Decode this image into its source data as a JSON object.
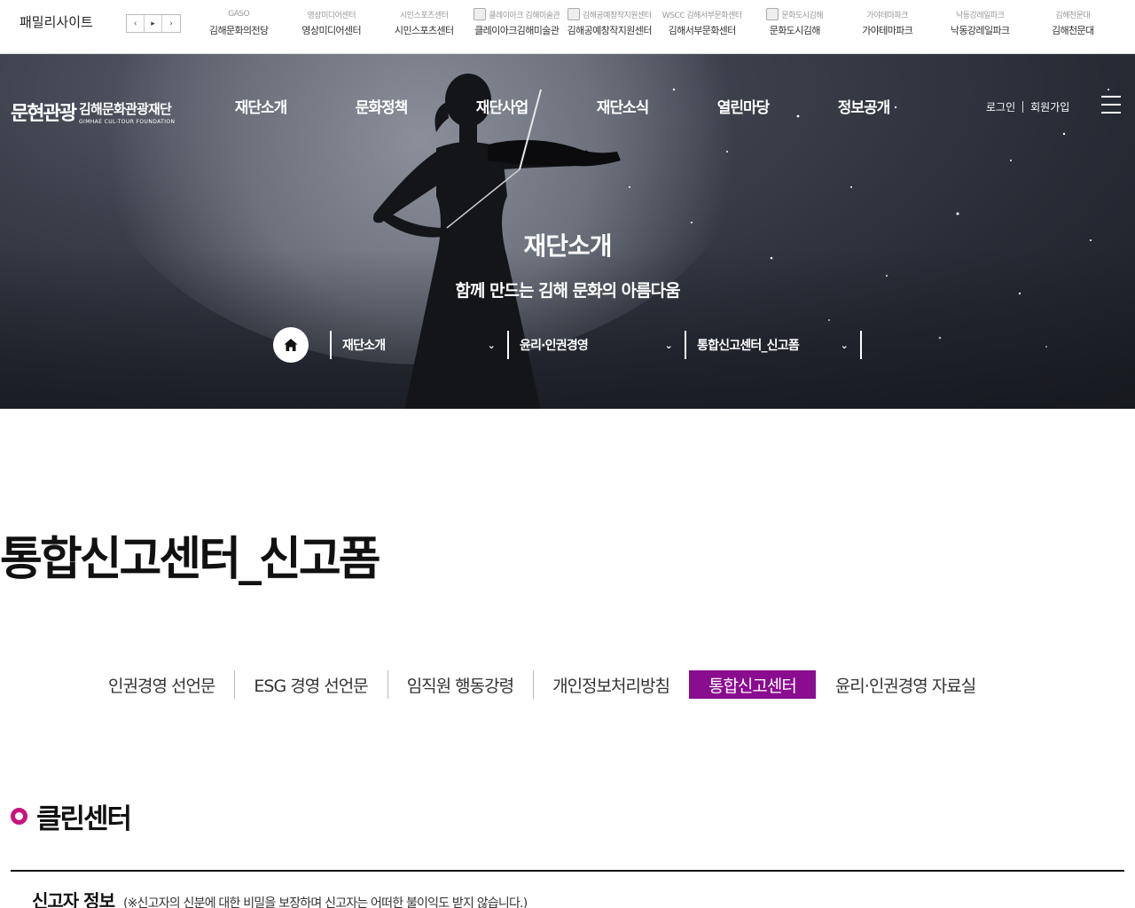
{
  "family": {
    "title": "패밀리사이트",
    "arrows": [
      "‹",
      "▸",
      "›"
    ],
    "sites": [
      {
        "logo": "GASO",
        "name": "김해문화의전당"
      },
      {
        "logo": "영상미디어센터",
        "name": "영상미디어센터"
      },
      {
        "logo": "시민스포츠센터",
        "name": "시민스포츠센터"
      },
      {
        "logo": "클레이아크 김해미술관",
        "name": "클레이아크김해미술관"
      },
      {
        "logo": "김해공예창작지원센터",
        "name": "김해공예창작지원센터"
      },
      {
        "logo": "WSCC 김해서부문화센터",
        "name": "김해서부문화센터"
      },
      {
        "logo": "문화도시김해",
        "name": "문화도시김해"
      },
      {
        "logo": "가야테마파크",
        "name": "가야테마파크"
      },
      {
        "logo": "낙동강레일파크",
        "name": "낙동강레일파크"
      },
      {
        "logo": "김해천문대",
        "name": "김해천문대"
      }
    ]
  },
  "header": {
    "logo_mark": "문현관광",
    "logo_ko": "김해문화관광재단",
    "logo_en": "GIMHAE CUL-TOUR FOUNDATION",
    "nav": [
      "재단소개",
      "문화정책",
      "재단사업",
      "재단소식",
      "열린마당",
      "정보공개"
    ],
    "login": "로그인",
    "join": "회원가입"
  },
  "hero": {
    "title": "재단소개",
    "subtitle": "함께 만드는 김해 문화의 아름다움",
    "breadcrumb": [
      "재단소개",
      "윤리·인권경영",
      "통합신고센터_신고폼"
    ]
  },
  "page": {
    "title": "통합신고센터_신고폼",
    "tabs": [
      "인권경영 선언문",
      "ESG 경영 선언문",
      "임직원 행동강령",
      "개인정보처리방침",
      "통합신고센터",
      "윤리·인권경영 자료실"
    ],
    "active_tab": 4,
    "section_title": "클린센터",
    "reporter_heading": "신고자 정보",
    "reporter_note": "(※신고자의 신분에 대한 비밀을 보장하며 신고자는 어떠한 불이익도 받지 않습니다.)"
  },
  "colors": {
    "accent": "#8a0c8f",
    "ring": "#c8147f"
  }
}
